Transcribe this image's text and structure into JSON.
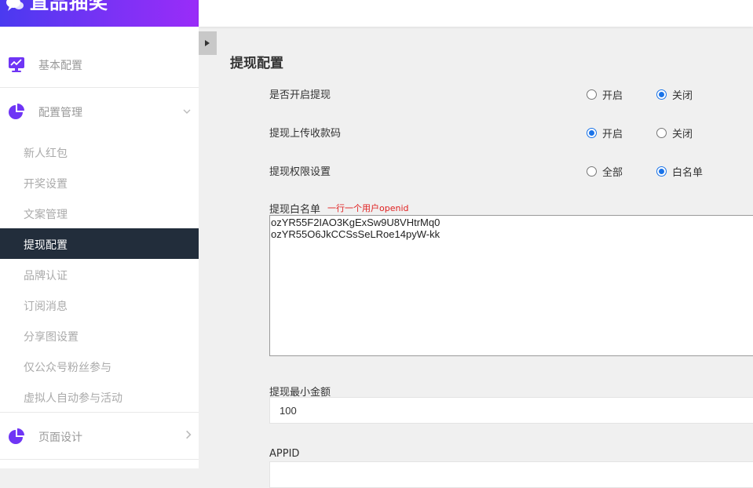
{
  "brand": {
    "title": "直品抽奖"
  },
  "sidebar": {
    "groups": [
      {
        "label": "基本配置",
        "icon": "monitor-chart-icon"
      },
      {
        "label": "配置管理",
        "icon": "pie-chart-icon",
        "expanded": true
      },
      {
        "label": "页面设计",
        "icon": "pie-chart-icon",
        "expanded": false
      }
    ],
    "sub_items": [
      {
        "label": "新人红包"
      },
      {
        "label": "开奖设置"
      },
      {
        "label": "文案管理"
      },
      {
        "label": "提现配置",
        "active": true
      },
      {
        "label": "品牌认证"
      },
      {
        "label": "订阅消息"
      },
      {
        "label": "分享图设置"
      },
      {
        "label": "仅公众号粉丝参与"
      },
      {
        "label": "虚拟人自动参与活动"
      }
    ]
  },
  "colors": {
    "accent": "#6f35f5",
    "active_bg": "#222d3b",
    "radio_blue": "#1a73e8",
    "hint_red": "#e02020"
  },
  "main": {
    "title": "提现配置",
    "rows": [
      {
        "label": "是否开启提现",
        "options": [
          "开启",
          "关闭"
        ],
        "selected": 1
      },
      {
        "label": "提现上传收款码",
        "options": [
          "开启",
          "关闭"
        ],
        "selected": 0
      },
      {
        "label": "提现权限设置",
        "options": [
          "全部",
          "白名单"
        ],
        "selected": 1
      }
    ],
    "whitelist": {
      "label": "提现白名单",
      "hint": "一行一个用户openid",
      "value": "ozYR55F2IAO3KgExSw9U8VHtrMq0\nozYR55O6JkCCSsSeLRoe14pyW-kk"
    },
    "min_amount": {
      "label": "提现最小金额",
      "value": "100"
    },
    "appid": {
      "label": "APPID",
      "value": ""
    }
  }
}
